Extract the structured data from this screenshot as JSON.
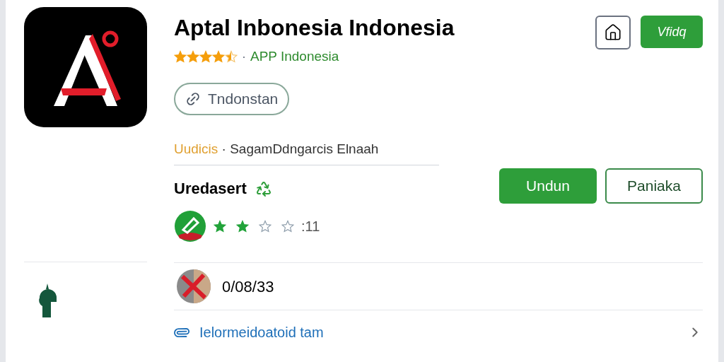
{
  "app": {
    "title": "Aptal Inbonesia Indonesia",
    "stars": 4.5,
    "separator": "·",
    "publisher": "APP Indonesia",
    "chip": "Tndonstan"
  },
  "header_buttons": [
    {
      "kind": "icon"
    },
    {
      "kind": "text",
      "label": "Vfidq"
    }
  ],
  "meta": {
    "highlight": "Uudicis",
    "text": "· SagamDdngarcis Elnaah"
  },
  "section": {
    "title": "Uredasert",
    "stars": 2,
    "count": ":11"
  },
  "actions": [
    {
      "label": "Undun",
      "primary": true
    },
    {
      "label": "Paniaka",
      "primary": false
    }
  ],
  "entry": {
    "text": "0/08/33"
  },
  "link": {
    "text": "Ielormeidoatoid tam"
  }
}
